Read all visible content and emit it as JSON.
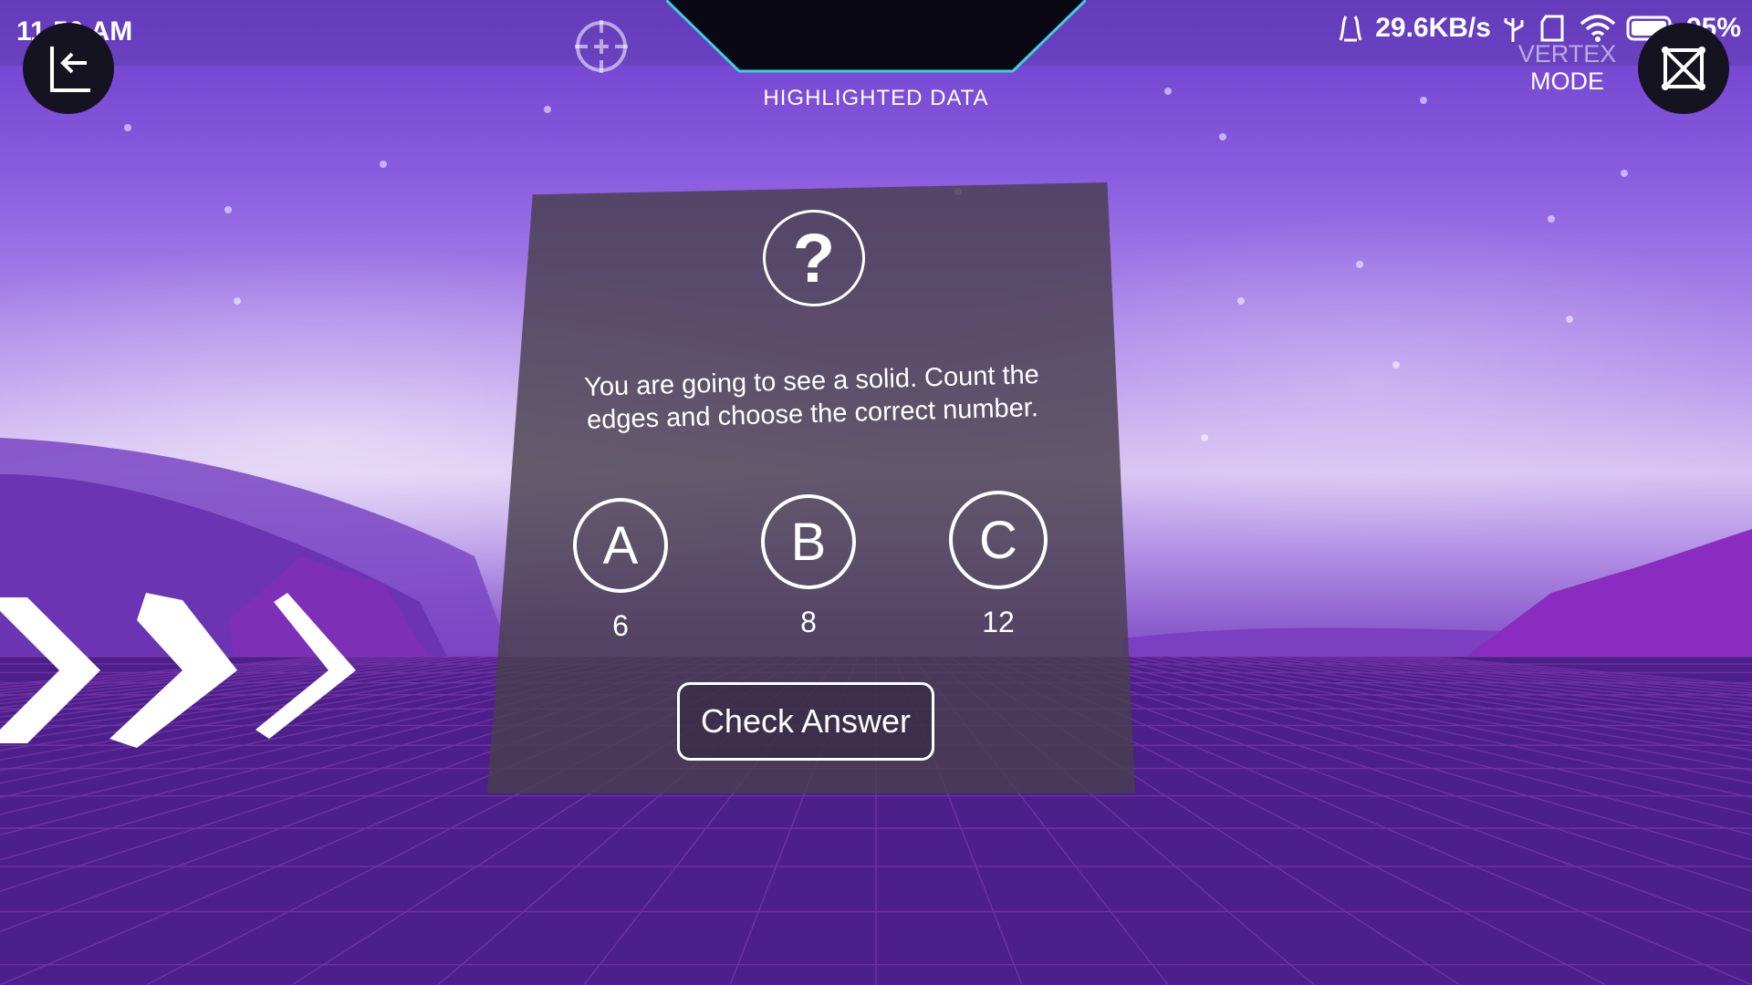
{
  "status_bar": {
    "time": "11 50 AM",
    "network_speed": "29.6KB/s",
    "battery": "95%"
  },
  "header": {
    "title": "HIGHLIGHTED DATA",
    "back_icon": "back-arrow-icon",
    "crosshair_icon": "crosshair-icon"
  },
  "vertex_mode": {
    "ghost_label": "VERTEX",
    "label": "MODE",
    "icon": "cube-frame-icon"
  },
  "quiz": {
    "icon": "question-mark-icon",
    "question": "You are going to see a solid. Count the edges and choose the correct number.",
    "options": [
      {
        "letter": "A",
        "value": "6"
      },
      {
        "letter": "B",
        "value": "8"
      },
      {
        "letter": "C",
        "value": "12"
      }
    ],
    "check_button": "Check Answer"
  },
  "colors": {
    "sky_top": "#6c3bc9",
    "sky_mid": "#d8c3f2",
    "ground": "#4a1f8a",
    "panel": "#48404e",
    "accent_cyan": "#3fd0e0"
  }
}
